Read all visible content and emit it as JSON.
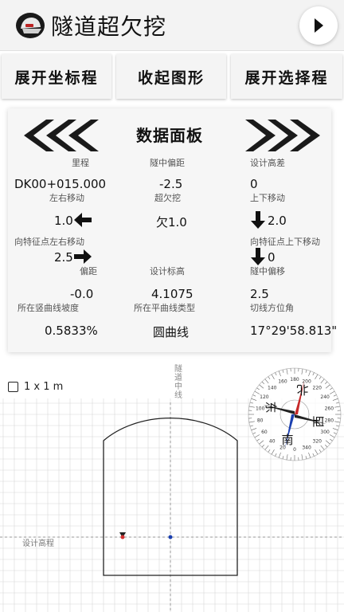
{
  "header": {
    "title": "隧道超欠挖",
    "app_icon": "helmet-icon",
    "menu_icon": "play-arrow-icon"
  },
  "buttons": {
    "expand_coords": "展开坐标程",
    "collapse_shape": "收起图形",
    "expand_select": "展开选择程"
  },
  "panel": {
    "title": "数据面板",
    "rows": {
      "mileage_label": "里程",
      "mileage_value": "DK00+015.000",
      "center_offset_label": "隧中偏距",
      "center_offset_value": "-2.5",
      "design_height_diff_label": "设计高差",
      "design_height_diff_value": "0",
      "lr_move_label": "左右移动",
      "lr_move_value": "1.0",
      "over_under_label": "超欠挖",
      "over_under_value": "欠1.0",
      "ud_move_label": "上下移动",
      "ud_move_value": "2.0",
      "feature_lr_label": "向特征点左右移动",
      "feature_lr_value": "2.5",
      "feature_ud_label": "向特征点上下移动",
      "feature_ud_value": "0",
      "offset_label": "偏距",
      "offset_value": "-0.0",
      "design_elev_label": "设计标高",
      "design_elev_value": "4.1075",
      "center_shift_label": "隧中偏移",
      "center_shift_value": "2.5",
      "vertical_slope_label": "所在竖曲线坡度",
      "vertical_slope_value": "0.5833%",
      "plane_curve_label": "所在平曲线类型",
      "plane_curve_value": "圆曲线",
      "tangent_label": "切线方位角",
      "tangent_value": "17°29'58.813\""
    }
  },
  "graphic": {
    "scale_label": "1 x 1 m",
    "center_axis_label": "隧道中线",
    "design_elevation_label": "设计高程",
    "compass": {
      "north": "北",
      "south": "南",
      "east": "东",
      "west": "西",
      "ticks": [
        "0",
        "20",
        "40",
        "60",
        "80",
        "100",
        "120",
        "140",
        "160",
        "180",
        "200",
        "220",
        "240",
        "260",
        "280",
        "300",
        "320",
        "340"
      ]
    },
    "colors": {
      "grid": "#d8d8d8",
      "axis": "#9a9a9a",
      "outline": "#222222",
      "point_red": "#d32f2f",
      "point_blue": "#1a3fb0"
    }
  }
}
